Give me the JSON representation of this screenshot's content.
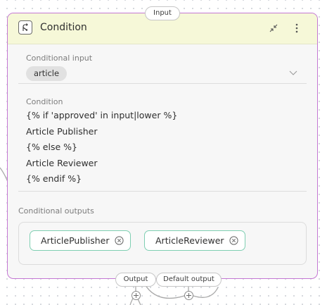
{
  "ports": {
    "input_label": "Input",
    "output_label": "Output",
    "default_output_label": "Default output"
  },
  "node": {
    "title": "Condition",
    "icon": "branch-icon",
    "header_color": "#f6f8d8",
    "border_color": "#c478d3"
  },
  "conditional_input": {
    "label": "Conditional input",
    "value": "article"
  },
  "condition": {
    "label": "Condition",
    "lines": [
      "{% if 'approved' in input|lower %}",
      "Article Publisher",
      "{% else %}",
      "Article Reviewer",
      "{% endif %}"
    ]
  },
  "conditional_outputs": {
    "label": "Conditional outputs",
    "items": [
      "ArticlePublisher",
      "ArticleReviewer"
    ],
    "chip_border_color": "#7fcfb2"
  }
}
